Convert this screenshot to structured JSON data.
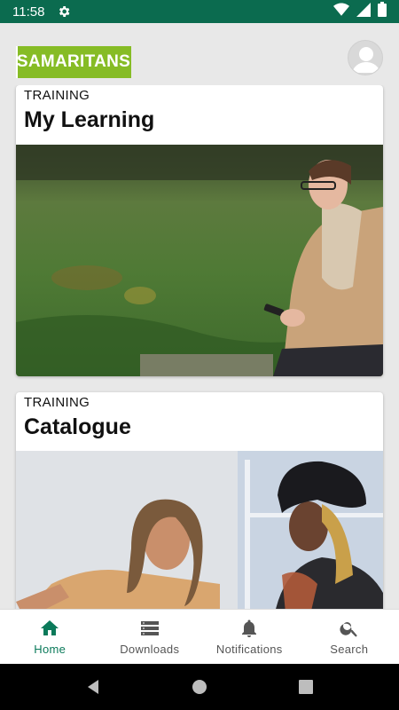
{
  "status_bar": {
    "time": "11:58",
    "icons": [
      "gear-icon",
      "wifi-icon",
      "signal-icon",
      "battery-icon"
    ]
  },
  "header": {
    "logo_text": "SAMARITANS",
    "brand_color": "#86bc25",
    "avatar_icon": "user-avatar-icon"
  },
  "cards": [
    {
      "overline": "TRAINING",
      "title": "My Learning",
      "image": "man-with-scarf-using-phone-photo"
    },
    {
      "overline": "TRAINING",
      "title": "Catalogue",
      "image": "two-women-talking-photo"
    }
  ],
  "bottom_nav": {
    "items": [
      {
        "label": "Home",
        "icon": "home-icon",
        "active": true
      },
      {
        "label": "Downloads",
        "icon": "downloads-icon",
        "active": false
      },
      {
        "label": "Notifications",
        "icon": "bell-icon",
        "active": false
      },
      {
        "label": "Search",
        "icon": "search-icon",
        "active": false
      }
    ],
    "accent_color": "#0b7a5a"
  },
  "system_nav": [
    "back-icon",
    "home-circle-icon",
    "recents-icon"
  ]
}
